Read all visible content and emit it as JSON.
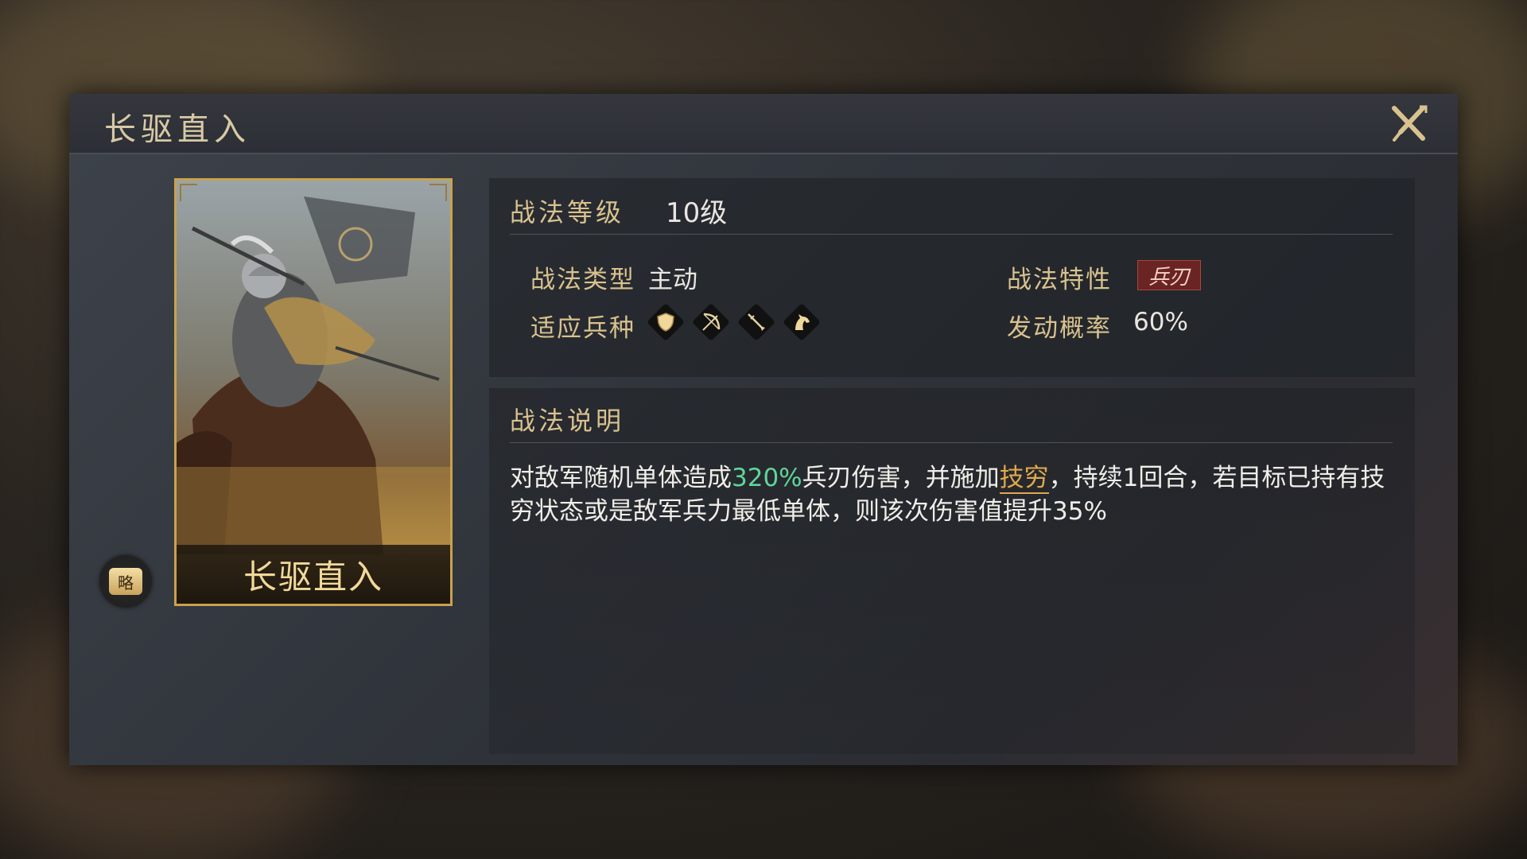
{
  "dialog": {
    "title": "长驱直入",
    "close_icon": "close-icon"
  },
  "card": {
    "name": "长驱直入",
    "strategy_badge": "略"
  },
  "info": {
    "level_label": "战法等级",
    "level_value": "10级",
    "type_label": "战法类型",
    "type_value": "主动",
    "trait_label": "战法特性",
    "trait_value": "兵刃",
    "units_label": "适应兵种",
    "units": [
      "shield-icon",
      "bow-icon",
      "spear-icon",
      "horse-icon"
    ],
    "rate_label": "发动概率",
    "rate_value": "60%"
  },
  "description": {
    "title": "战法说明",
    "part1": "对敌军随机单体造成",
    "highlight_value": "320%",
    "part2": "兵刃伤害，并施加",
    "link_text": "技穷",
    "part3": "，持续1回合，若目标已持有技穷状态或是敌军兵力最低单体，则该次伤害值提升35%"
  },
  "colors": {
    "gold": "#d9c28e",
    "highlight_green": "#5ed69a",
    "link_orange": "#e0a94c",
    "trait_red": "#6a2424"
  }
}
